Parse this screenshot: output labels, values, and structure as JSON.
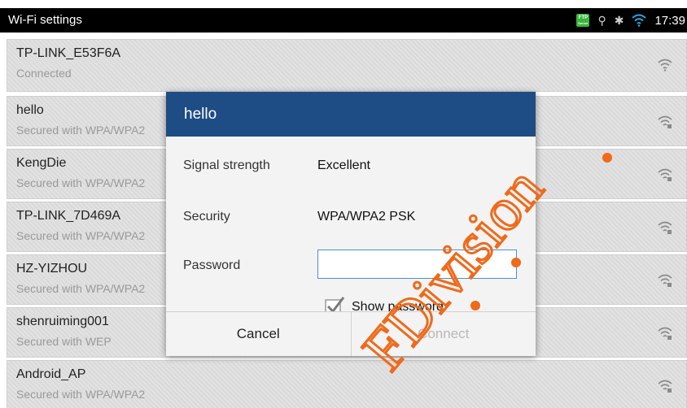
{
  "status_bar": {
    "title": "Wi-Fi settings",
    "ftp_badge_top": "FTP",
    "ftp_badge_bottom": "Server",
    "usb_icon": "usb-icon",
    "bt_icon": "bluetooth-icon",
    "time": "17:39"
  },
  "networks": [
    {
      "ssid": "TP-LINK_E53F6A",
      "status": "Connected"
    },
    {
      "ssid": "hello",
      "status": "Secured with WPA/WPA2"
    },
    {
      "ssid": "KengDie",
      "status": "Secured with WPA/WPA2"
    },
    {
      "ssid": "TP-LINK_7D469A",
      "status": "Secured with WPA/WPA2"
    },
    {
      "ssid": "HZ-YIZHOU",
      "status": "Secured with WPA/WPA2"
    },
    {
      "ssid": "shenruiming001",
      "status": "Secured with WEP"
    },
    {
      "ssid": "Android_AP",
      "status": "Secured with WPA/WPA2"
    }
  ],
  "dialog": {
    "title": "hello",
    "signal_label": "Signal strength",
    "signal_value": "Excellent",
    "security_label": "Security",
    "security_value": "WPA/WPA2 PSK",
    "password_label": "Password",
    "password_value": "",
    "show_password_label": "Show password",
    "show_password_checked": true,
    "cancel_label": "Cancel",
    "connect_label": "Connect"
  },
  "watermark": {
    "text": "FDivision"
  },
  "colors": {
    "dialog_header": "#1e4c84",
    "status_bar": "#000000",
    "watermark": "#ef6a1a"
  }
}
